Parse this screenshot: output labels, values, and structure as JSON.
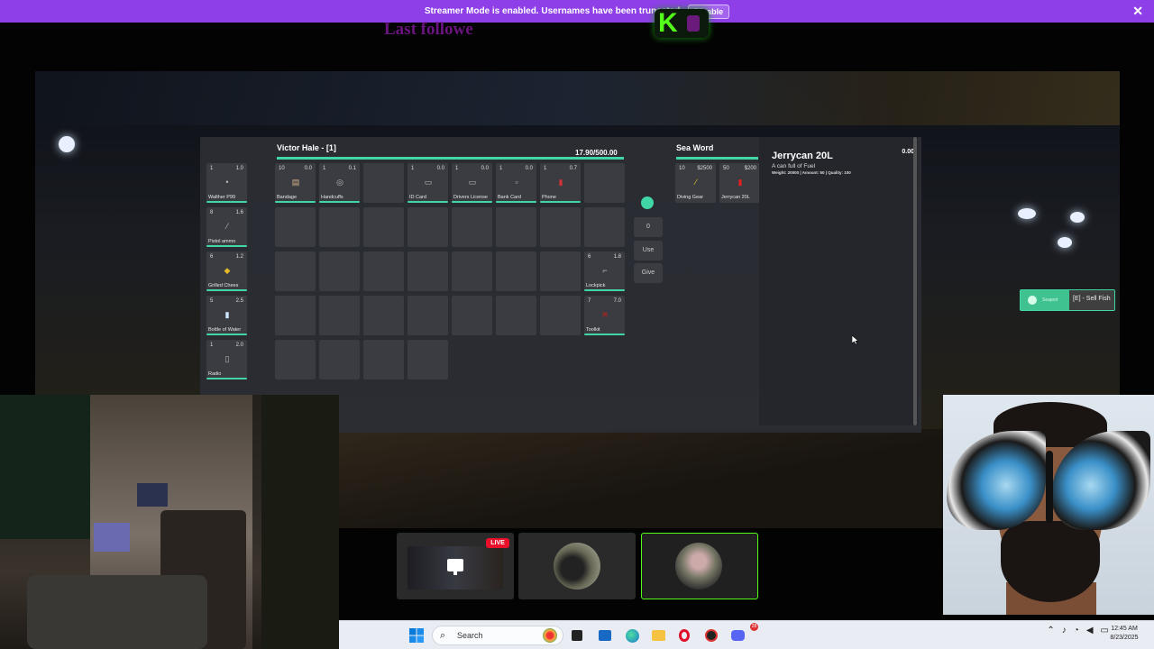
{
  "banner": {
    "message": "Streamer Mode is enabled. Usernames have been truncated.",
    "disable_label": "Disable",
    "close": "✕",
    "color": "#8e3fe8"
  },
  "overlay": {
    "last_follower": "Last followe"
  },
  "kick_logo": {
    "letter": "K"
  },
  "inventory": {
    "player_title": "Victor Hale - [1]",
    "weight": "17.90/500.00",
    "hotbar": [
      {
        "qty": "1",
        "weight": "1.0",
        "name": "Walther P99",
        "icon": "•"
      },
      {
        "qty": "8",
        "weight": "1.6",
        "name": "Pistol ammo",
        "icon": "⁄"
      },
      {
        "qty": "6",
        "weight": "1.2",
        "name": "Grilled Chees",
        "icon": "◆"
      },
      {
        "qty": "5",
        "weight": "2.5",
        "name": "Bottle of Water",
        "icon": "▮"
      },
      {
        "qty": "1",
        "weight": "2.0",
        "name": "Radio",
        "icon": "▯"
      }
    ],
    "row1": [
      {
        "qty": "10",
        "weight": "0.0",
        "name": "Bandage",
        "icon": "▤"
      },
      {
        "qty": "1",
        "weight": "0.1",
        "name": "Handcuffs",
        "icon": "◎"
      },
      {
        "qty": "",
        "weight": "",
        "name": "",
        "icon": ""
      },
      {
        "qty": "1",
        "weight": "0.0",
        "name": "ID Card",
        "icon": "▭"
      },
      {
        "qty": "1",
        "weight": "0.0",
        "name": "Drivers License",
        "icon": "▭"
      },
      {
        "qty": "1",
        "weight": "0.0",
        "name": "Bank Card",
        "icon": "▫"
      },
      {
        "qty": "1",
        "weight": "0.7",
        "name": "Phone",
        "icon": "▮"
      }
    ],
    "lockpick": {
      "qty": "6",
      "weight": "1.8",
      "name": "Lockpick",
      "icon": "⌐"
    },
    "toolkit": {
      "qty": "7",
      "weight": "7.0",
      "name": "Toolkit",
      "icon": "✖"
    },
    "amount_value": "0",
    "use_label": "Use",
    "give_label": "Give",
    "accent": "#41d6a6"
  },
  "shop": {
    "title": "Sea Word",
    "items": [
      {
        "qty": "10",
        "price": "$2500",
        "name": "Diving Gear",
        "icon": "⁄"
      },
      {
        "qty": "50",
        "price": "$200",
        "name": "Jerrycan 20L",
        "icon": "▮"
      }
    ]
  },
  "detail": {
    "name": "Jerrycan 20L",
    "description": "A can full of Fuel",
    "stats": "Weight: 20000 | Amount: 50 | Quality: 100",
    "weight_value": "0.00"
  },
  "sell_prompt": {
    "label": "Seaport",
    "key_label": "[E] - Sell Fish"
  },
  "stream_cards": {
    "live_label": "LIVE"
  },
  "taskbar": {
    "search_label": "Search",
    "time": "12:45 AM",
    "date": "8/23/2025",
    "notification_count": "28"
  }
}
